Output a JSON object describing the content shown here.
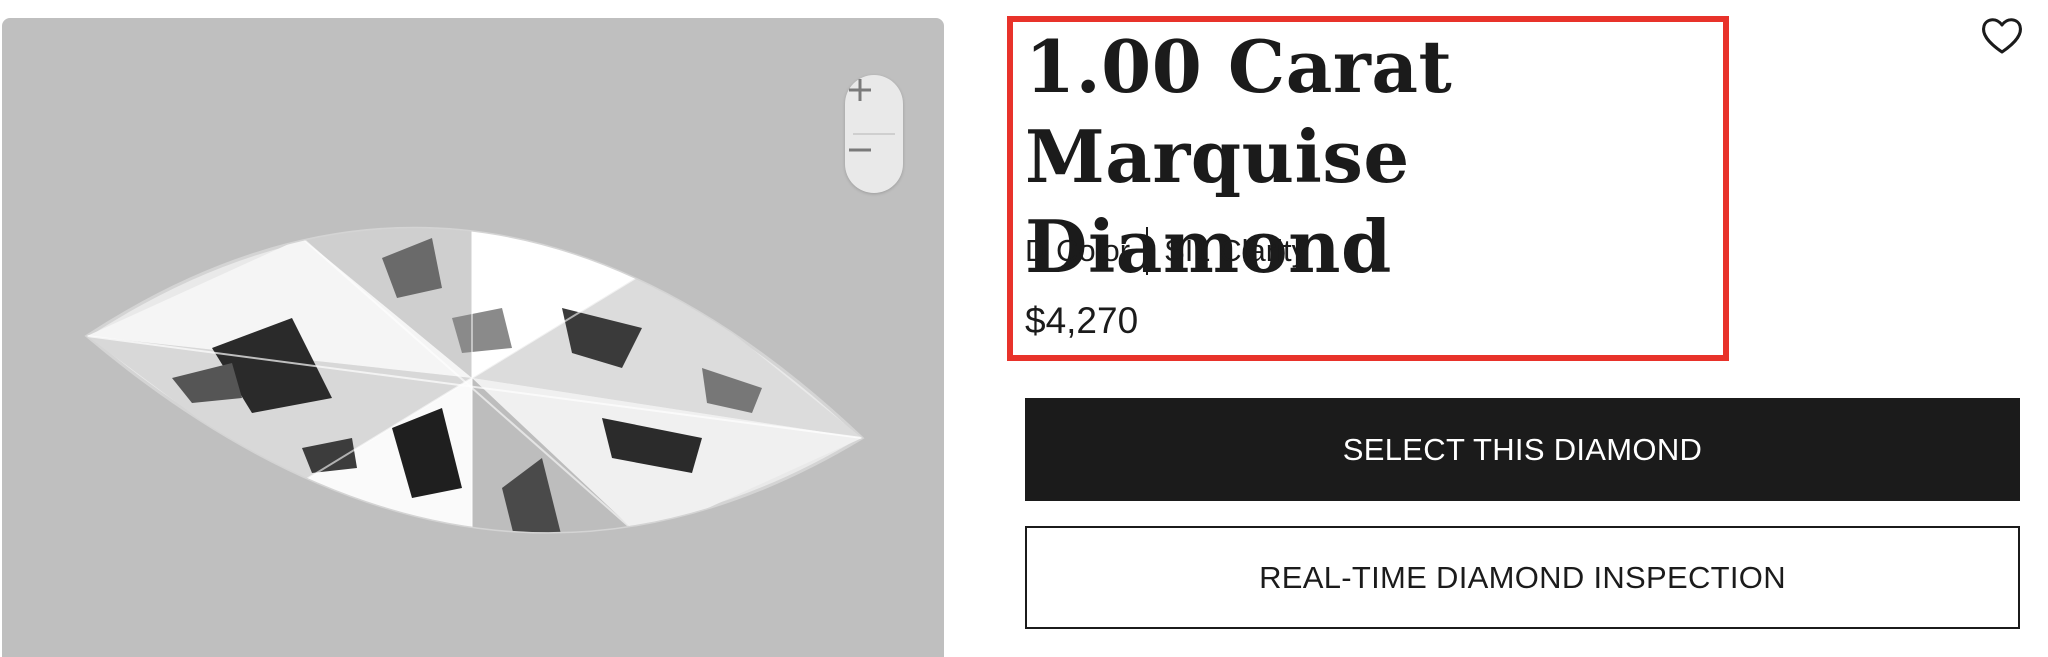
{
  "product": {
    "title": "1.00 Carat Marquise Diamond",
    "color_spec": "D Color",
    "clarity_spec": "SI1 Clarity",
    "price": "$4,270"
  },
  "gallery": {
    "image_subject": "marquise diamond",
    "zoom_in_label": "+",
    "zoom_out_label": "−"
  },
  "actions": {
    "select_label": "SELECT THIS DIAMOND",
    "inspection_label": "REAL-TIME DIAMOND INSPECTION"
  },
  "icons": {
    "favorite": "heart-outline-icon",
    "zoom_in": "plus-icon",
    "zoom_out": "minus-icon"
  },
  "colors": {
    "highlight": "#e8322a",
    "primary_button": "#1b1b1b",
    "image_background": "#bfbfbf"
  }
}
